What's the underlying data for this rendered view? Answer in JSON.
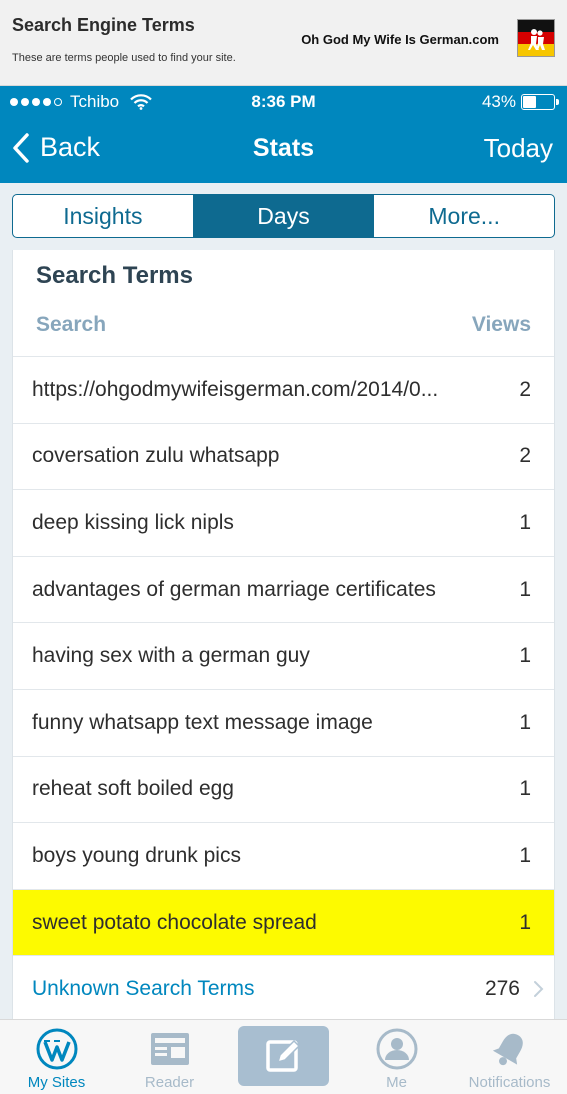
{
  "banner": {
    "title": "Search Engine Terms",
    "subtitle": "These are terms people used to find your site.",
    "site_name": "Oh God My Wife Is German.com",
    "flag_icon": "german-flag-logo-icon"
  },
  "status_bar": {
    "signal_dots_filled": 4,
    "signal_dots_total": 5,
    "carrier": "Tchibo",
    "time": "8:36 PM",
    "battery": "43%",
    "battery_level": 0.43
  },
  "nav": {
    "back_label": "Back",
    "title": "Stats",
    "right_label": "Today"
  },
  "segments": [
    {
      "label": "Insights",
      "active": false
    },
    {
      "label": "Days",
      "active": true
    },
    {
      "label": "More...",
      "active": false
    }
  ],
  "card": {
    "title": "Search Terms",
    "col_search": "Search",
    "col_views": "Views",
    "rows": [
      {
        "term": "https://ohgodmywifeisgerman.com/2014/0...",
        "views": "2"
      },
      {
        "term": "coversation zulu whatsapp",
        "views": "2"
      },
      {
        "term": "deep kissing lick nipls",
        "views": "1"
      },
      {
        "term": "advantages of german marriage certificates",
        "views": "1"
      },
      {
        "term": "having sex with a german guy",
        "views": "1"
      },
      {
        "term": "funny whatsapp text message image",
        "views": "1"
      },
      {
        "term": "reheat soft boiled egg",
        "views": "1"
      },
      {
        "term": "boys young drunk pics",
        "views": "1"
      },
      {
        "term": "sweet potato chocolate spread",
        "views": "1",
        "highlight": true
      }
    ],
    "unknown": {
      "label": "Unknown Search Terms",
      "views": "276"
    }
  },
  "tabbar": {
    "items": [
      {
        "label": "My Sites",
        "icon": "wordpress-icon",
        "active": true
      },
      {
        "label": "Reader",
        "icon": "reader-icon"
      },
      {
        "label": "",
        "icon": "write-post-icon"
      },
      {
        "label": "Me",
        "icon": "me-avatar-icon"
      },
      {
        "label": "Notifications",
        "icon": "bell-icon"
      }
    ]
  },
  "colors": {
    "header_blue": "#0087be",
    "segment_blue": "#0e6a90",
    "highlight_yellow": "#fdfa00",
    "muted_heading": "#87a6bc"
  }
}
